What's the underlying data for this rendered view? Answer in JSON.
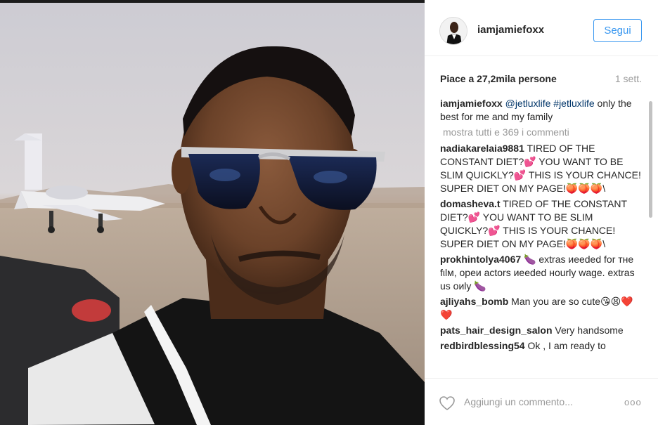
{
  "post": {
    "username": "iamjamiefoxx",
    "follow_label": "Segui",
    "likes": "Piace a 27,2mila persone",
    "time_ago": "1 sett."
  },
  "caption": {
    "author": "iamjamiefoxx",
    "mention": "@jetluxlife #jetluxlife",
    "text": "only the best for me and my family"
  },
  "view_all": "mostra tutti e 369 i commenti",
  "comments": [
    {
      "author": "nadiakarelaia9881",
      "text": "TIRED OF THE CONSTANT DIET?💕 YOU WANT TO BE SLIM QUICKLY?💕 THIS IS YOUR CHANCE! SUPER DIET ON MY PAGE!🍑🍑🍑\\"
    },
    {
      "author": "domasheva.t",
      "text": "TIRED OF THE CONSTANT DIET?💕 YOU WANT TO BE SLIM QUICKLY?💕 THIS IS YOUR CHANCE! SUPER DIET ON MY PAGE!🍑🍑🍑\\"
    },
    {
      "author": "prokhintolya4067",
      "text": "🍆 extras иeeded for тнe fιlм, opeи actors иeeded нourly wage. extras us oиly 🍆"
    },
    {
      "author": "ajliyahs_bomb",
      "text": "Man you are so cute😘😫❤️❤️"
    },
    {
      "author": "pats_hair_design_salon",
      "text": "Very handsome"
    },
    {
      "author": "redbirdblessing54",
      "text": "Ok , I am ready to"
    }
  ],
  "composer": {
    "placeholder": "Aggiungi un commento...",
    "more_label": "ooo"
  },
  "colors": {
    "accent": "#3897f0",
    "muted": "#999999",
    "mention": "#003569"
  }
}
